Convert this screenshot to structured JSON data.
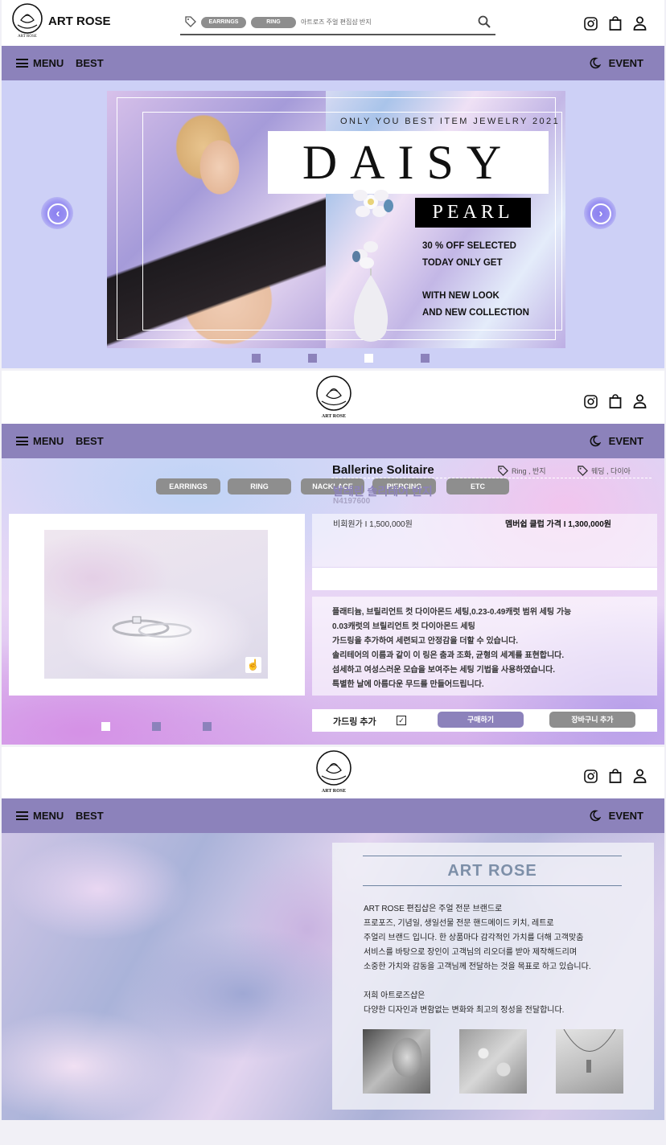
{
  "brand": {
    "name": "ART ROSE",
    "logo_text": "ART ROSE"
  },
  "search": {
    "tags": [
      "EARRINGS",
      "RING"
    ],
    "placeholder": "아트로즈 주얼 편집샵 반지"
  },
  "nav": {
    "menu": "MENU",
    "best": "BEST",
    "event": "EVENT"
  },
  "hero": {
    "tagline": "ONLY YOU BEST ITEM JEWELRY 2021",
    "title": "DAISY",
    "subtitle": "PEARL",
    "promo": [
      "30 % OFF SELECTED",
      "TODAY ONLY GET",
      "WITH NEW LOOK",
      "AND NEW  COLLECTION"
    ],
    "slides": 4,
    "active_slide": 3
  },
  "product": {
    "categories": [
      "EARRINGS",
      "RING",
      "NACKLACE",
      "PIERCING",
      "ETC"
    ],
    "name": "Ballerine Solitaire",
    "name_kr": "발레린 솔리테어 반지",
    "code": "N4197600",
    "tag1": "Ring , 반지",
    "tag2": "웨딩 , 다이아",
    "price_nonmember": "비회원가  I  1,500,000원",
    "price_member": "멤버쉽 클럽 가격  I  1,300,000원",
    "description": [
      "플래티늄, 브릴리언트 컷 다이아몬드 세팅,0.23-0.49캐럿 범위 세팅 가능",
      "0.03캐럿의 브릴리언트 컷 다이아몬드 세팅",
      "가드링을 추가하여 세련되고 안정감을 더할 수 있습니다.",
      "솔리테어의 이름과 같이 이 링은 춤과 조화, 균형의 세계를 표현합니다.",
      "섬세하고 여성스러운 모습을 보여주는 세팅 기법을 사용하였습니다.",
      "특별한 날에 아름다운 무드를 만들어드립니다."
    ],
    "guard_ring": "가드링 추가",
    "buy": "구매하기",
    "cart": "장바구니 추가",
    "image_dots": 3,
    "active_image_dot": 1
  },
  "about": {
    "title": "ART ROSE",
    "paragraph1": [
      "ART ROSE 편집샵은 주얼 전문 브랜드로",
      "프로포즈, 기념일, 생일선물 전문 핸드메이드 키치, 레트로",
      "주얼리 브랜드 입니다. 한 상품마다 감각적인 가치를 더해 고객맞춤",
      "서비스를 바탕으로 장인이 고객님의 리오더를 받아 제작해드리며",
      "소중한 가치와 감동을 고객님께 전달하는 것을 목표로 하고 있습니다."
    ],
    "paragraph2": [
      "저희 아트로즈샵은",
      "다양한 디자인과 변함없는 변화와 최고의 정성을 전달합니다."
    ]
  },
  "colors": {
    "nav": "#8c82bb",
    "hero_bg": "#cdd0f6",
    "pill_gray": "#8e8e8e",
    "accent_text": "#7d8fa8"
  },
  "icons": [
    "logo-icon",
    "tag-icon",
    "search-icon",
    "instagram-icon",
    "shopping-bag-icon",
    "user-icon",
    "menu-icon",
    "moon-icon",
    "chevron-left-icon",
    "chevron-right-icon",
    "zoom-icon",
    "checkbox-icon"
  ]
}
